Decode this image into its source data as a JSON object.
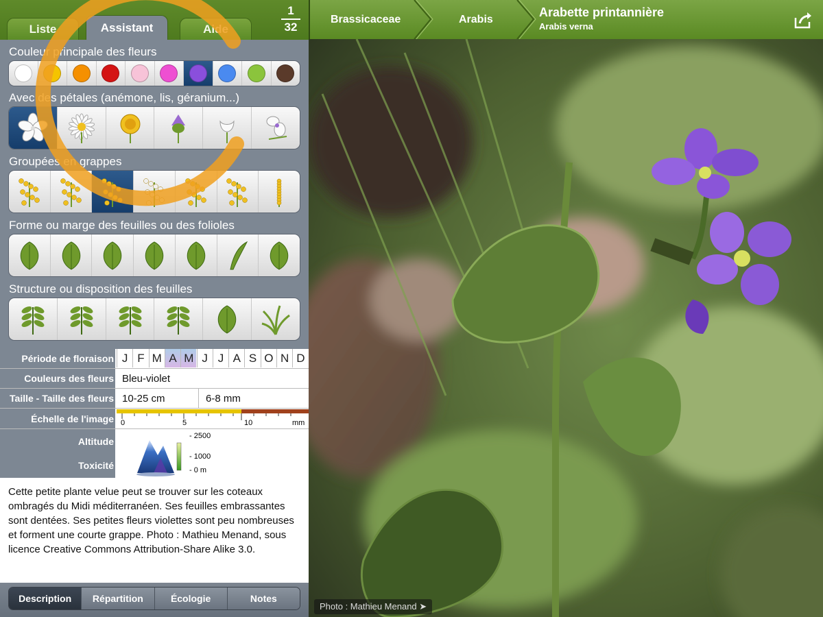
{
  "tabs": {
    "liste": "Liste",
    "assistant": "Assistant",
    "aide": "Aide"
  },
  "counter": {
    "current": "1",
    "total": "32"
  },
  "sections": {
    "colors_title": "Couleur principale des fleurs",
    "petals_title": "Avec des pétales (anémone, lis, géranium...)",
    "clusters_title": "Groupées en grappes",
    "leaf_shape_title": "Forme ou marge des feuilles ou des folioles",
    "leaf_structure_title": "Structure ou disposition des feuilles"
  },
  "flower_colors": [
    "#ffffff",
    "#f5c400",
    "#f59000",
    "#d41414",
    "#f7c3d8",
    "#ee4fd2",
    "#8a4fdc",
    "#4a8af0",
    "#8bc43c",
    "#5a3a2a"
  ],
  "icons": {
    "petals": [
      "five-petal-flower-icon",
      "daisy-icon",
      "dandelion-icon",
      "thistle-icon",
      "bell-flower-icon",
      "orchid-icon"
    ],
    "clusters": [
      "umbel-yellow-icon",
      "raceme-yellow-icon",
      "branched-cluster-icon",
      "umbel-white-icon",
      "spike-yellow-icon",
      "umbel-fennel-icon",
      "narrow-spike-icon"
    ],
    "leaf_shapes": [
      "oval-leaf-icon",
      "lobed-leaf-icon",
      "maple-leaf-icon",
      "oak-leaf-icon",
      "dissected-leaf-icon",
      "linear-leaf-icon",
      "toothed-leaf-icon"
    ],
    "leaf_structures": [
      "opposite-leaves-icon",
      "pinnate-leaves-icon",
      "palmate-leaves-icon",
      "whorled-leaves-icon",
      "basal-leaf-icon",
      "grass-tuft-icon"
    ]
  },
  "info": {
    "flowering_label": "Période de floraison",
    "months": [
      "J",
      "F",
      "M",
      "A",
      "M",
      "J",
      "J",
      "A",
      "S",
      "O",
      "N",
      "D"
    ],
    "colors_label": "Couleurs des fleurs",
    "colors_value": "Bleu-violet",
    "size_label": "Taille - Taille des fleurs",
    "size_plant": "10-25 cm",
    "size_flower": "6-8 mm",
    "scale_label": "Échelle de l'image",
    "scale_ticks": [
      "0",
      "5",
      "10",
      "mm"
    ],
    "altitude_label": "Altitude",
    "toxicity_label": "Toxicité",
    "altitude_ticks": [
      "2500",
      "1000",
      "0 m"
    ]
  },
  "description": "Cette petite plante velue peut se trouver sur les coteaux ombragés du Midi méditerranéen. Ses feuilles embrassantes sont dentées. Ses petites fleurs violettes sont peu nombreuses et forment une courte grappe. Photo : Mathieu Menand, sous licence Creative Commons Attribution-Share Alike 3.0.",
  "bottom_tabs": [
    "Description",
    "Répartition",
    "Écologie",
    "Notes"
  ],
  "breadcrumb": {
    "family": "Brassicaceae",
    "genus": "Arabis"
  },
  "species": {
    "common": "Arabette printannière",
    "latin": "Arabis verna"
  },
  "photo_credit": "Photo : Mathieu Menand ➤",
  "accent": "#5f8a2a",
  "highlight_color": "#f0a020"
}
